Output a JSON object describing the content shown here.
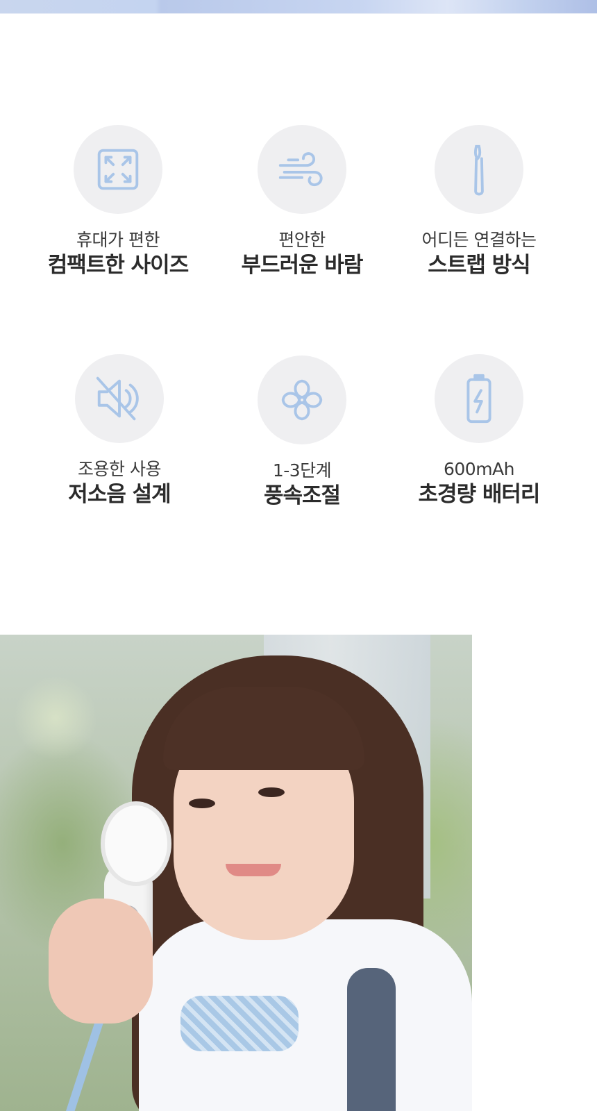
{
  "features": [
    {
      "icon": "compact-size-icon",
      "caption": "휴대가 편한",
      "title": "컴팩트한 사이즈"
    },
    {
      "icon": "wind-icon",
      "caption": "편안한",
      "title": "부드러운 바람"
    },
    {
      "icon": "strap-icon",
      "caption": "어디든 연결하는",
      "title": "스트랩 방식"
    },
    {
      "icon": "mute-speaker-icon",
      "caption": "조용한 사용",
      "title": "저소음 설계"
    },
    {
      "icon": "fan-icon",
      "caption": "1-3단계",
      "title": "풍속조절"
    },
    {
      "icon": "battery-icon",
      "caption": "600mAh",
      "title": "초경량 배터리"
    }
  ],
  "colors": {
    "icon_stroke": "#a9c5e8",
    "circle_bg": "#efeff1",
    "title_text": "#2b2b2b",
    "caption_text": "#3a3a3a"
  }
}
